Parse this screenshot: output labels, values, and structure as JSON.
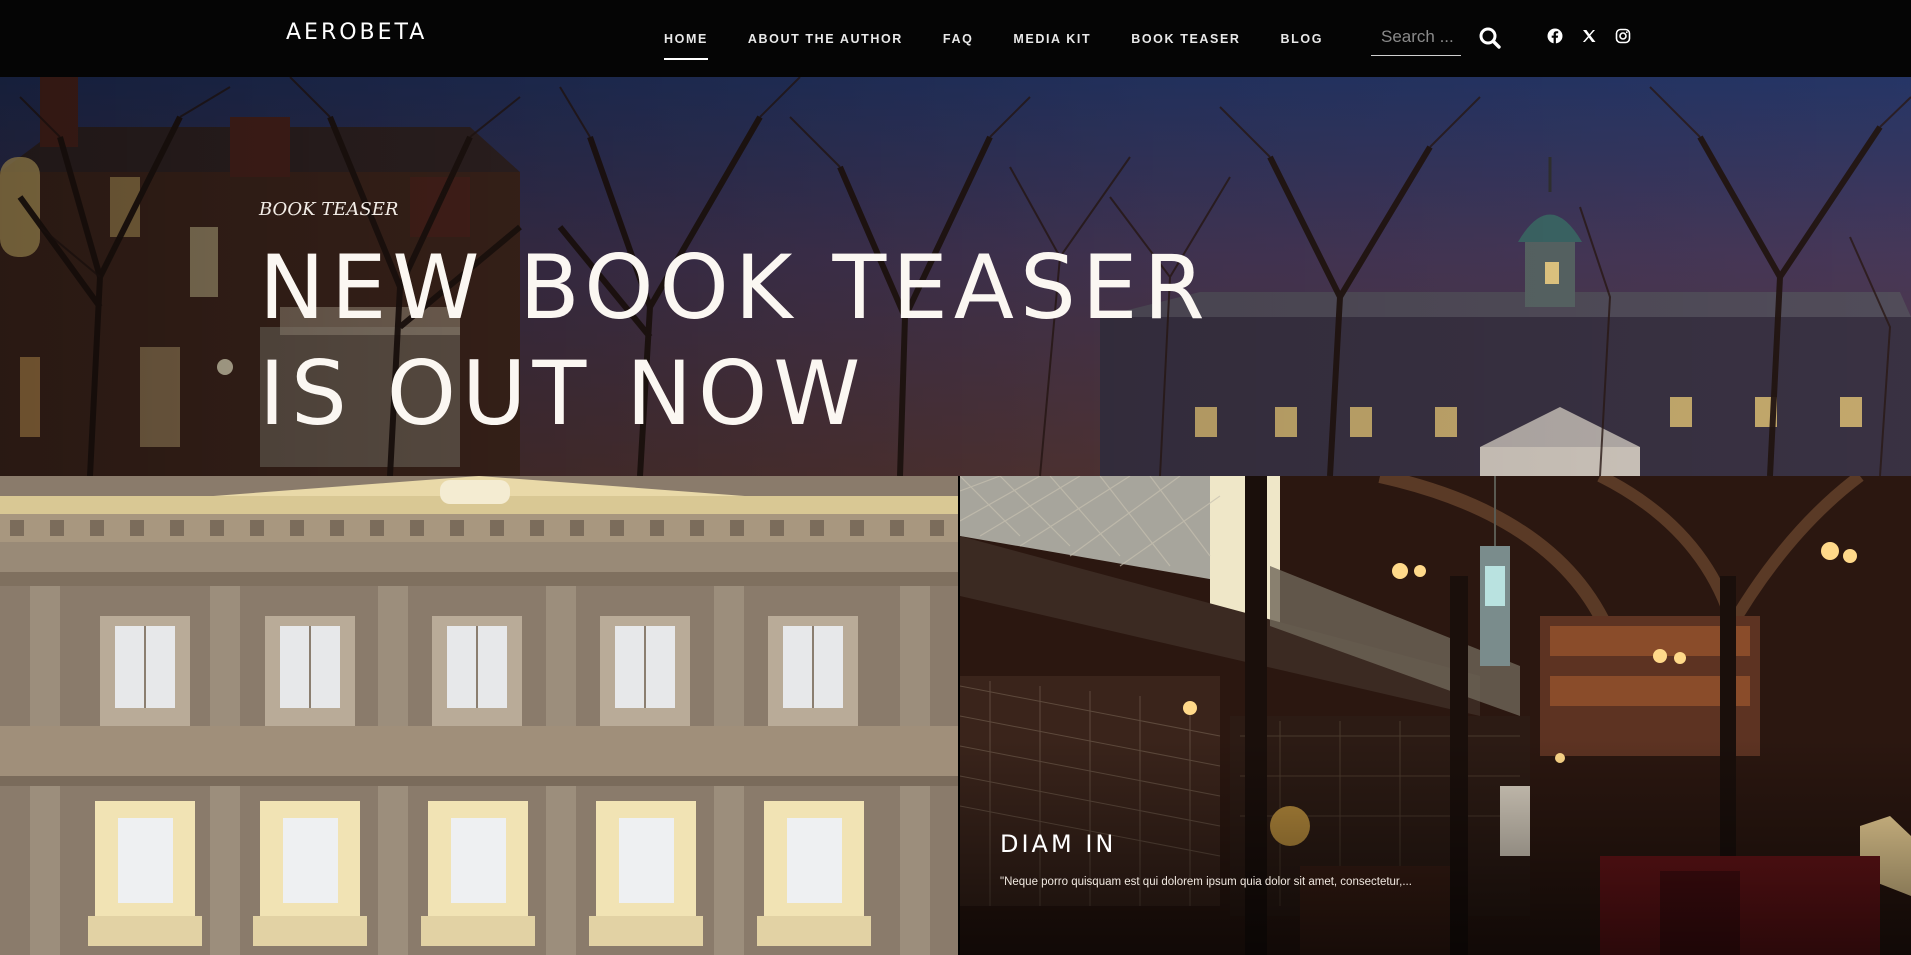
{
  "header": {
    "logo": "AEROBETA",
    "nav": [
      "HOME",
      "ABOUT THE AUTHOR",
      "FAQ",
      "MEDIA KIT",
      "BOOK TEASER",
      "BLOG"
    ],
    "active_nav": "HOME",
    "search": {
      "placeholder": "Search ..."
    },
    "social_icons": [
      "facebook-icon",
      "x-icon",
      "instagram-icon"
    ]
  },
  "hero": {
    "kicker": "BOOK TEASER",
    "title_line1": "NEW BOOK TEASER",
    "title_line2": "IS OUT NOW"
  },
  "cards": [
    {
      "title": "",
      "excerpt": ""
    },
    {
      "title": "DIAM IN",
      "excerpt": "\"Neque porro quisquam est qui dolorem ipsum quia dolor sit amet, consectetur,..."
    }
  ],
  "colors": {
    "header_bg": "#050505",
    "text": "#ffffff",
    "hero_sky": "#2c3563"
  }
}
